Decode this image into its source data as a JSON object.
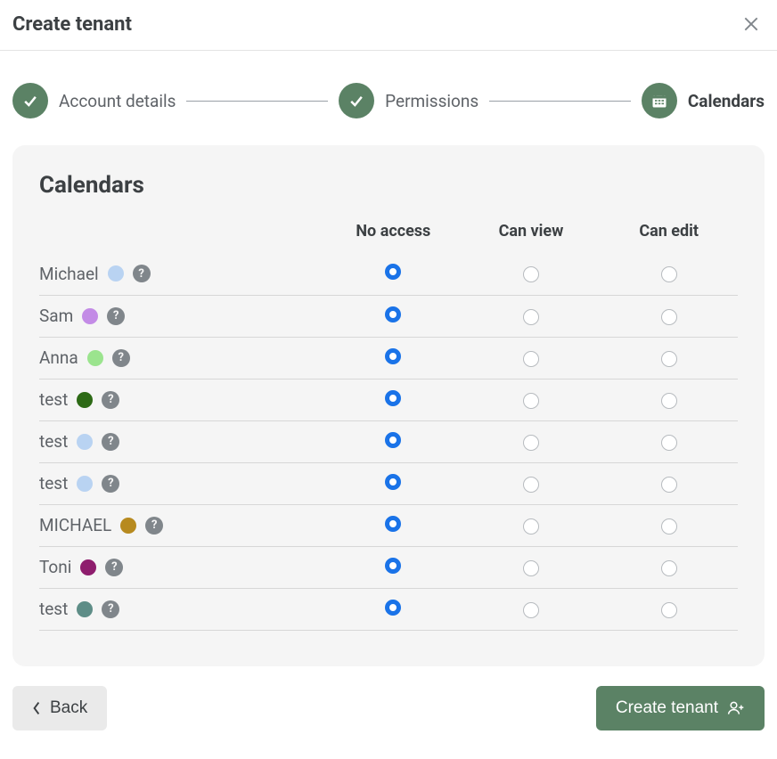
{
  "dialog": {
    "title": "Create tenant"
  },
  "stepper": {
    "steps": [
      {
        "label": "Account details",
        "state": "done"
      },
      {
        "label": "Permissions",
        "state": "done"
      },
      {
        "label": "Calendars",
        "state": "active"
      }
    ]
  },
  "card": {
    "title": "Calendars",
    "columns": {
      "no_access": "No access",
      "can_view": "Can view",
      "can_edit": "Can edit"
    }
  },
  "calendars": [
    {
      "name": "Michael",
      "color": "#b9d3f2",
      "access": "no_access"
    },
    {
      "name": "Sam",
      "color": "#c38be6",
      "access": "no_access"
    },
    {
      "name": "Anna",
      "color": "#9be48e",
      "access": "no_access"
    },
    {
      "name": "test",
      "color": "#2d6a16",
      "access": "no_access"
    },
    {
      "name": "test",
      "color": "#b9d3f2",
      "access": "no_access"
    },
    {
      "name": "test",
      "color": "#b9d3f2",
      "access": "no_access"
    },
    {
      "name": "MICHAEL",
      "color": "#b78a1f",
      "access": "no_access"
    },
    {
      "name": "Toni",
      "color": "#8e1d6d",
      "access": "no_access"
    },
    {
      "name": "test",
      "color": "#5e8d87",
      "access": "no_access"
    }
  ],
  "footer": {
    "back": "Back",
    "submit": "Create tenant"
  }
}
